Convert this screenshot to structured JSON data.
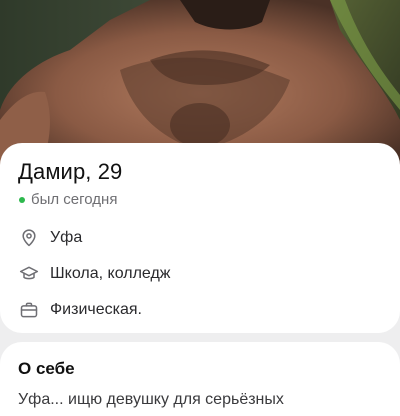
{
  "profile": {
    "name_age": "Дамир, 29",
    "status": "был сегодня",
    "status_color": "#2db84d",
    "city": "Уфа",
    "education": "Школа, колледж",
    "job": "Физическая."
  },
  "about": {
    "title": "О себе",
    "text": "Уфа... ищю девушку для серьёзных"
  },
  "icons": {
    "city": "location-pin-icon",
    "education": "graduation-cap-icon",
    "job": "briefcase-icon"
  }
}
